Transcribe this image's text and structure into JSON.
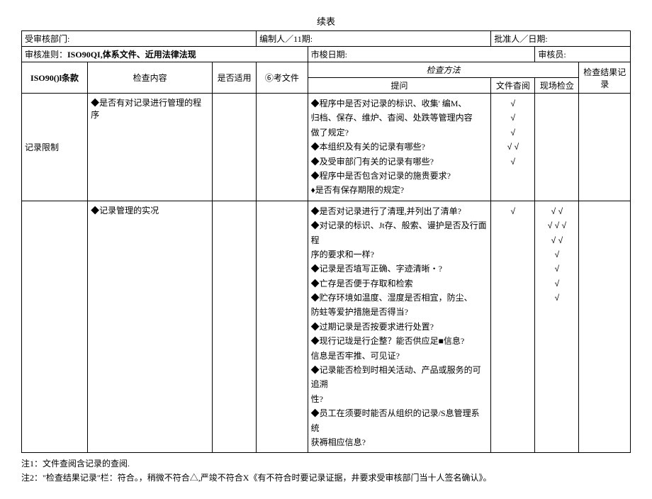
{
  "title": "续表",
  "header": {
    "dept_label": "受审核部门:",
    "compiler_label": "编制人／11期:",
    "approver_label": "批准人／日期:",
    "criteria_label": "审核准则：",
    "criteria_value": "ISO90QI,体系文件、近用法律法现",
    "auditdate_label": "市梭日期:",
    "auditor_label": "审核员:"
  },
  "thead": {
    "clause": "ISO90()l条款",
    "content": "检查内容",
    "applicable": "是否适用",
    "refdoc": "⑥考文件",
    "method": "检查方法",
    "question": "提问",
    "docrev": "文件杳阅",
    "onsite": "现场检佥",
    "result": "检查结果记录"
  },
  "rows": [
    {
      "clause": "记录限制",
      "content": "◆是否有对记录进行管理的程序",
      "questions": [
        "◆程序中是否对记录的标识、收集' 编M、",
        "归档、保存、维炉、杳阅、处跌等管理内容",
        "做了规定?",
        "◆本组织及有关的记录有哪些?",
        "◆及受审部门有关的记录有哪些?",
        "◆程序中是否包含对记录的施贵要求?",
        "♦是否有保存期限的规定?"
      ],
      "docrev": [
        "",
        "√",
        "",
        "√",
        "√",
        "√ √",
        "√"
      ],
      "onsite": [
        "",
        "",
        "",
        "",
        "",
        "",
        ""
      ]
    },
    {
      "clause": "",
      "content": "◆记录管理的实况",
      "questions": [
        "◆是否对记录进行了清理,并列出了清单?",
        "◆对记录的标识、Jt存、般索、谩护是否及行面程",
        "序的要求和一样?",
        "◆记录是否埴写正确、字迹清晰・?",
        "◆亡存是否便于存取和检索",
        "◆贮存环境如温度、湿度是否相宜，防尘、",
        "防蛀等爱护措施是否得当?",
        "◆过期记录是否按要求进行处置?",
        "◆现行记珑是行企整？能否供应足■信息?",
        "信息是否牢推、可见证?",
        "◆记录能否检到时相关活动、产品或服务的可追溯",
        "性?",
        "◆员工在须要时能否从组织的记录/S息管理系统",
        "获褥相应信息?"
      ],
      "docrev": [
        "√",
        "",
        "",
        "",
        "",
        "",
        "",
        "",
        "",
        "",
        "",
        "",
        "",
        ""
      ],
      "onsite": [
        "√ √",
        "√ √ √",
        "",
        "",
        "√ √",
        "√",
        "√",
        "√",
        "√",
        "",
        "",
        "",
        "",
        ""
      ]
    }
  ],
  "notes": {
    "note1": "注1：文件查阅含记录的查阅.",
    "note2": "注2：\"检查结果记录\"栏：符合。，稍微不符合△,严竣不符合X《有不符合时要记录证据，井要求受审核部门当十人签名确认》。"
  }
}
